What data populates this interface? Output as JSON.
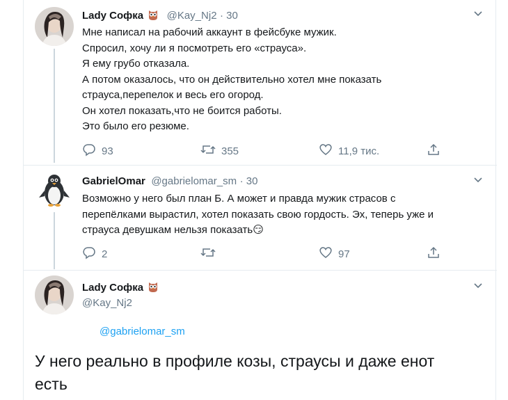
{
  "tweets": [
    {
      "author": "Lady Софка",
      "handle": "@Kay_Nj2",
      "time": "· 30",
      "text": "Мне написал на рабочий аккаунт в фейсбуке мужик.\nСпросил, хочу ли я посмотреть его «страуса».\nЯ ему грубо отказала.\nА потом оказалось, что он действительно хотел мне показать\nстрауса,перепелок и весь его огород.\nОн хотел показать,что не боится работы.\nЭто было его резюме.",
      "replies": "93",
      "retweets": "355",
      "likes": "11,9 тис."
    },
    {
      "author": "GabrielOmar",
      "handle": "@gabrielomar_sm",
      "time": "· 30",
      "text": "Возможно у него был план Б. А может и правда мужик страсов с\nперепёлками вырастил, хотел показать свою гордость. Эх, теперь уже и\nстрауса девушкам нельзя показать",
      "emoji": "😏",
      "replies": "2",
      "retweets": "",
      "likes": "97"
    }
  ],
  "focused": {
    "author": "Lady Софка",
    "handle": "@Kay_Nj2",
    "replying_to": "@gabrielomar_sm",
    "text": "У него реально в профиле козы, страусы и даже енот\nесть"
  },
  "colors": {
    "text": "#14171a",
    "secondary": "#657786",
    "link": "#1da1f2",
    "border": "#e6ecf0"
  }
}
